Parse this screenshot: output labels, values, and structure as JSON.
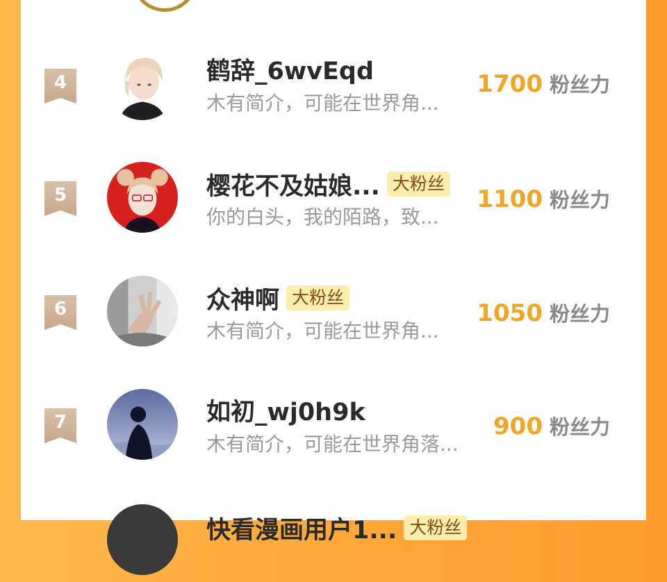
{
  "ranking": {
    "score_unit": "粉丝力",
    "items": [
      {
        "rank": "4",
        "username": "鹤辞_6wvEqd",
        "badge": "",
        "bio": "木有简介，可能在世界角...",
        "score": "1700"
      },
      {
        "rank": "5",
        "username": "樱花不及姑娘...",
        "badge": "大粉丝",
        "bio": "你的白头，我的陌路，致...",
        "score": "1100"
      },
      {
        "rank": "6",
        "username": "众神啊",
        "badge": "大粉丝",
        "bio": "木有简介，可能在世界角...",
        "score": "1050"
      },
      {
        "rank": "7",
        "username": "如初_wj0h9k",
        "badge": "",
        "bio": "木有简介，可能在世界角落...",
        "score": "900"
      },
      {
        "rank": "",
        "username": "快看漫画用户1...",
        "badge": "大粉丝",
        "bio": "",
        "score": ""
      }
    ]
  }
}
